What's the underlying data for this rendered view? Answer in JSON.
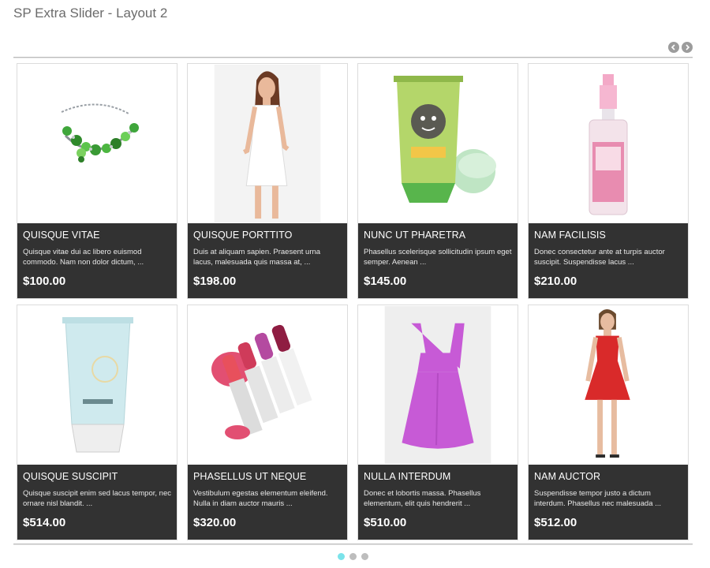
{
  "header": {
    "title": "SP Extra Slider - Layout 2"
  },
  "nav": {
    "prev_symbol": "‹",
    "next_symbol": "›"
  },
  "products": [
    {
      "title": "QUISQUE VITAE",
      "desc": "Quisque vitae dui ac libero euismod commodo. Nam non dolor dictum, ...",
      "price": "$100.00",
      "image": "bracelet"
    },
    {
      "title": "QUISQUE PORTTITO",
      "desc": "Duis at aliquam sapien. Praesent urna lacus, malesuada quis massa at, ...",
      "price": "$198.00",
      "image": "white-dress"
    },
    {
      "title": "NUNC UT PHARETRA",
      "desc": "Phasellus scelerisque sollicitudin ipsum eget semper. Aenean ...",
      "price": "$145.00",
      "image": "clay-pack-tube"
    },
    {
      "title": "NAM FACILISIS",
      "desc": "Donec consectetur ante at turpis auctor suscipit. Suspendisse lacus ...",
      "price": "$210.00",
      "image": "spray-bottle"
    },
    {
      "title": "QUISQUE SUSCIPIT",
      "desc": "Quisque suscipit enim sed lacus tempor, nec ornare nisl blandit. ...",
      "price": "$514.00",
      "image": "cream-tube"
    },
    {
      "title": "PHASELLUS UT NEQUE",
      "desc": "Vestibulum egestas elementum eleifend. Nulla in diam auctor mauris ...",
      "price": "$320.00",
      "image": "lipsticks"
    },
    {
      "title": "NULLA INTERDUM",
      "desc": "Donec et lobortis massa. Phasellus elementum, elit quis hendrerit ...",
      "price": "$510.00",
      "image": "purple-dress"
    },
    {
      "title": "NAM AUCTOR",
      "desc": "Suspendisse tempor justo a dictum interdum. Phasellus nec malesuada ...",
      "price": "$512.00",
      "image": "red-dress"
    }
  ],
  "pagination": {
    "pages": 3,
    "active": 1
  },
  "colors": {
    "info_bg": "#323232",
    "dot_active": "#7be3ea",
    "dot_inactive": "#bdbdbd"
  }
}
